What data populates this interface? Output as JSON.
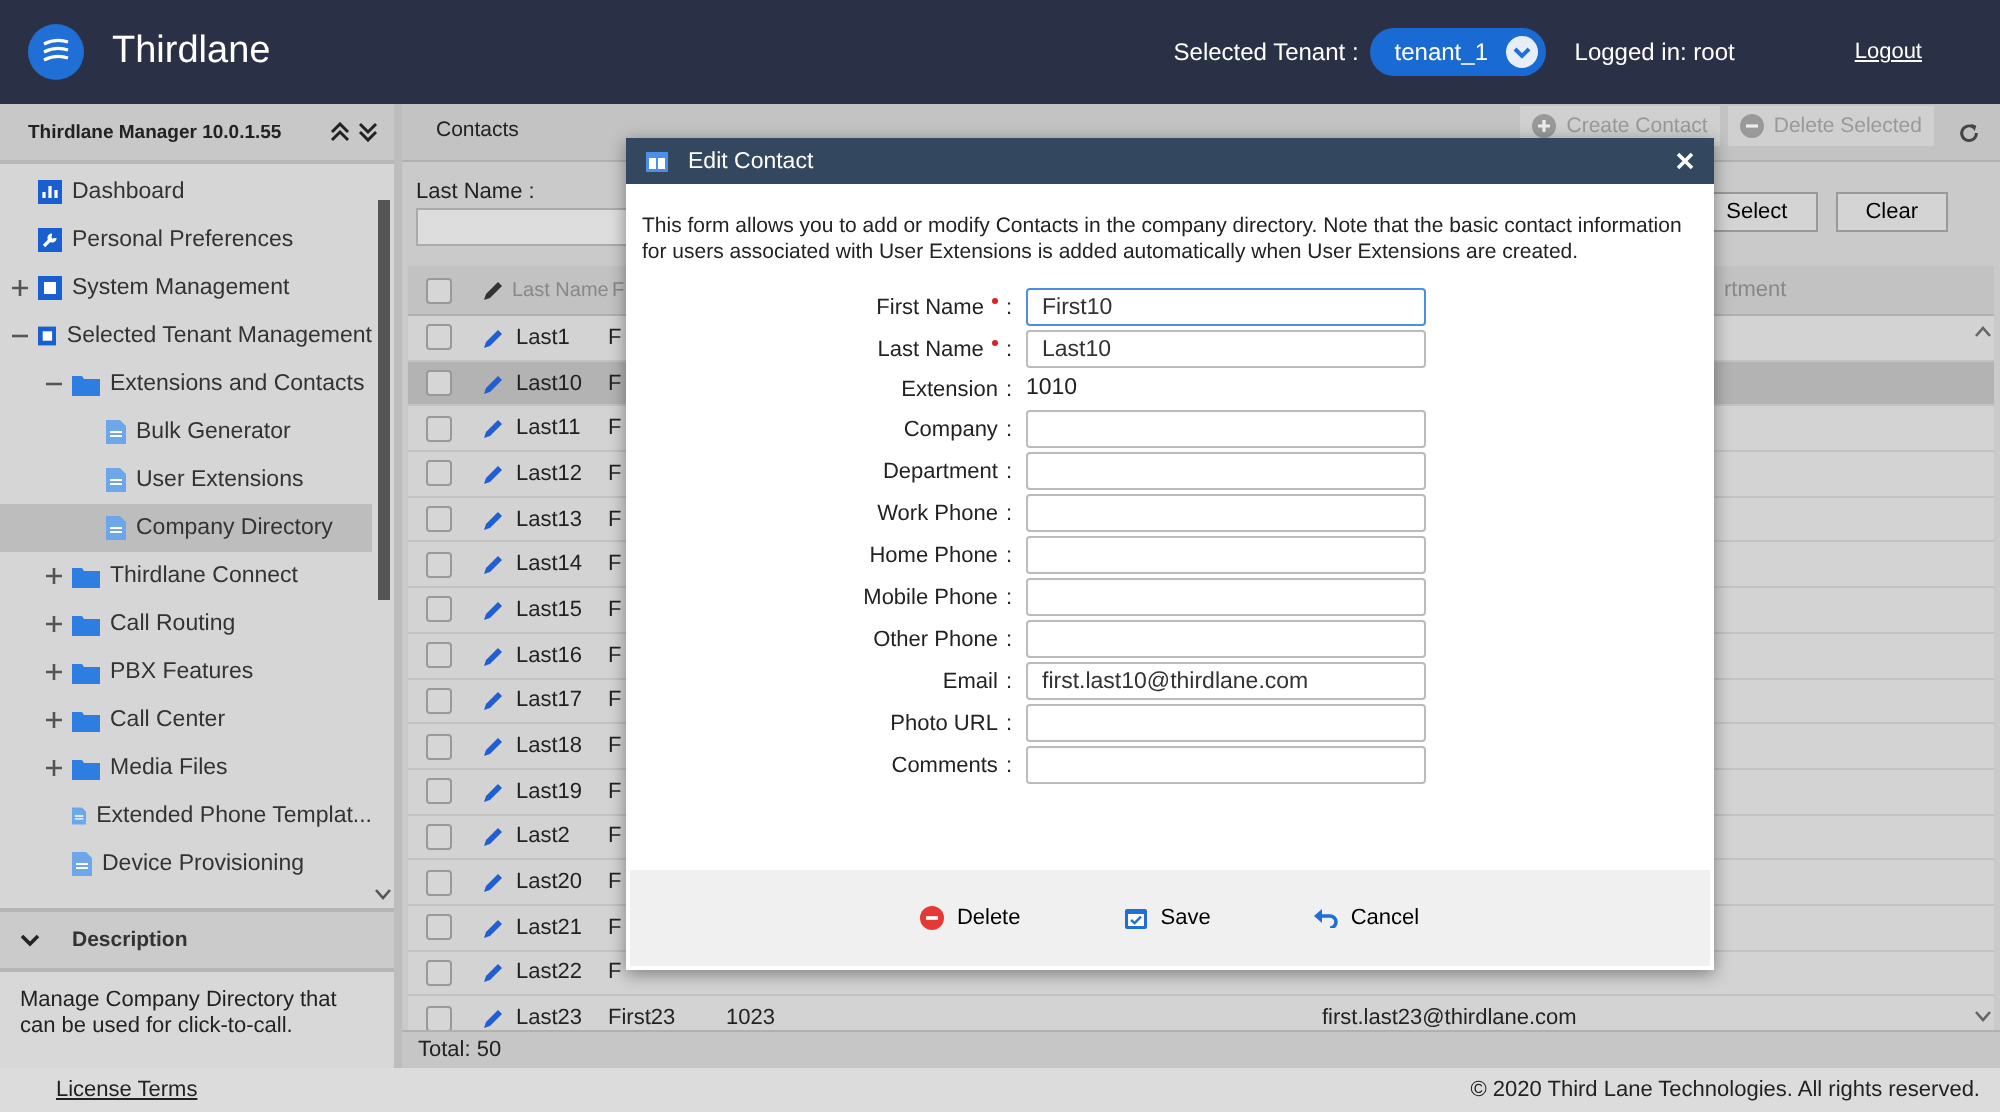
{
  "header": {
    "app_name": "Thirdlane",
    "tenant_label": "Selected Tenant :",
    "tenant": "tenant_1",
    "logged_in": "Logged in: root",
    "logout": "Logout"
  },
  "sidebar": {
    "title": "Thirdlane Manager 10.0.1.55",
    "items": [
      {
        "label": "Dashboard",
        "kind": "chart"
      },
      {
        "label": "Personal Preferences",
        "kind": "wrench"
      },
      {
        "label": "System Management",
        "kind": "section",
        "expanded": false
      },
      {
        "label": "Selected Tenant Management",
        "kind": "section",
        "expanded": true,
        "children": [
          {
            "label": "Extensions and Contacts",
            "kind": "folder",
            "expanded": true,
            "children": [
              {
                "label": "Bulk Generator",
                "kind": "doc",
                "selected": false
              },
              {
                "label": "User Extensions",
                "kind": "doc",
                "selected": false
              },
              {
                "label": "Company Directory",
                "kind": "doc",
                "selected": true
              }
            ]
          },
          {
            "label": "Thirdlane Connect",
            "kind": "folder",
            "expanded": false
          },
          {
            "label": "Call Routing",
            "kind": "folder",
            "expanded": false
          },
          {
            "label": "PBX Features",
            "kind": "folder",
            "expanded": false
          },
          {
            "label": "Call Center",
            "kind": "folder",
            "expanded": false
          },
          {
            "label": "Media Files",
            "kind": "folder",
            "expanded": false
          },
          {
            "label": "Extended Phone Templat...",
            "kind": "doc",
            "selected": false
          },
          {
            "label": "Device Provisioning",
            "kind": "doc",
            "selected": false
          }
        ]
      }
    ]
  },
  "description": {
    "title": "Description",
    "text": "Manage Company Directory that can be used for click-to-call."
  },
  "toolbar": {
    "title": "Contacts",
    "buttons": [
      {
        "label": "Create Contact",
        "kind": "plus",
        "disabled": true
      },
      {
        "label": "Delete Selected",
        "kind": "minus",
        "disabled": true
      }
    ]
  },
  "filter": {
    "label": "Last Name :",
    "buttons": [
      "Select",
      "Clear"
    ]
  },
  "table": {
    "all_checked": false,
    "columns": [
      "Last Name",
      "F",
      "rtment"
    ],
    "rows": [
      {
        "last": "Last1",
        "first": "F",
        "checked": false,
        "selected": false
      },
      {
        "last": "Last10",
        "first": "F",
        "checked": false,
        "selected": true
      },
      {
        "last": "Last11",
        "first": "F",
        "checked": false,
        "selected": false
      },
      {
        "last": "Last12",
        "first": "F",
        "checked": false,
        "selected": false
      },
      {
        "last": "Last13",
        "first": "F",
        "checked": false,
        "selected": false
      },
      {
        "last": "Last14",
        "first": "F",
        "checked": false,
        "selected": false
      },
      {
        "last": "Last15",
        "first": "F",
        "checked": false,
        "selected": false
      },
      {
        "last": "Last16",
        "first": "F",
        "checked": false,
        "selected": false
      },
      {
        "last": "Last17",
        "first": "F",
        "checked": false,
        "selected": false
      },
      {
        "last": "Last18",
        "first": "F",
        "checked": false,
        "selected": false
      },
      {
        "last": "Last19",
        "first": "F",
        "checked": false,
        "selected": false
      },
      {
        "last": "Last2",
        "first": "F",
        "checked": false,
        "selected": false
      },
      {
        "last": "Last20",
        "first": "F",
        "checked": false,
        "selected": false
      },
      {
        "last": "Last21",
        "first": "F",
        "checked": false,
        "selected": false
      },
      {
        "last": "Last22",
        "first": "F",
        "checked": false,
        "selected": false
      },
      {
        "last": "Last23",
        "first": "First23",
        "extension": "1023",
        "email": "first.last23@thirdlane.com",
        "checked": false,
        "selected": false
      }
    ],
    "total": "Total: 50"
  },
  "dialog": {
    "title": "Edit Contact",
    "intro": "This form allows you to add or modify Contacts in the company directory. Note that the basic contact information for users associated with User Extensions is added automatically when User Extensions are created.",
    "fields": [
      {
        "label": "First Name",
        "suffix": ":",
        "required": true,
        "kind": "input",
        "value": "First10",
        "focused": true
      },
      {
        "label": "Last Name",
        "suffix": ":",
        "required": true,
        "kind": "input",
        "value": "Last10",
        "focused": false
      },
      {
        "label": "Extension",
        "suffix": ":",
        "required": false,
        "kind": "text",
        "value": "1010"
      },
      {
        "label": "Company",
        "suffix": ":",
        "required": false,
        "kind": "input",
        "focused": false
      },
      {
        "label": "Department",
        "suffix": ":",
        "required": false,
        "kind": "input",
        "focused": false
      },
      {
        "label": "Work Phone",
        "suffix": ":",
        "required": false,
        "kind": "input",
        "focused": false
      },
      {
        "label": "Home Phone",
        "suffix": ":",
        "required": false,
        "kind": "input",
        "focused": false
      },
      {
        "label": "Mobile Phone",
        "suffix": ":",
        "required": false,
        "kind": "input",
        "focused": false
      },
      {
        "label": "Other Phone",
        "suffix": ":",
        "required": false,
        "kind": "input",
        "focused": false
      },
      {
        "label": "Email",
        "suffix": ":",
        "required": false,
        "kind": "input",
        "value": "first.last10@thirdlane.com",
        "focused": false
      },
      {
        "label": "Photo URL",
        "suffix": ":",
        "required": false,
        "kind": "input",
        "focused": false
      },
      {
        "label": "Comments",
        "suffix": ":",
        "required": false,
        "kind": "input",
        "focused": false
      }
    ],
    "buttons": [
      {
        "label": "Delete",
        "kind": "delete"
      },
      {
        "label": "Save",
        "kind": "save"
      },
      {
        "label": "Cancel",
        "kind": "cancel"
      }
    ]
  },
  "footer": {
    "license": "License Terms",
    "copyright": "© 2020 Third Lane Technologies. All rights reserved."
  }
}
